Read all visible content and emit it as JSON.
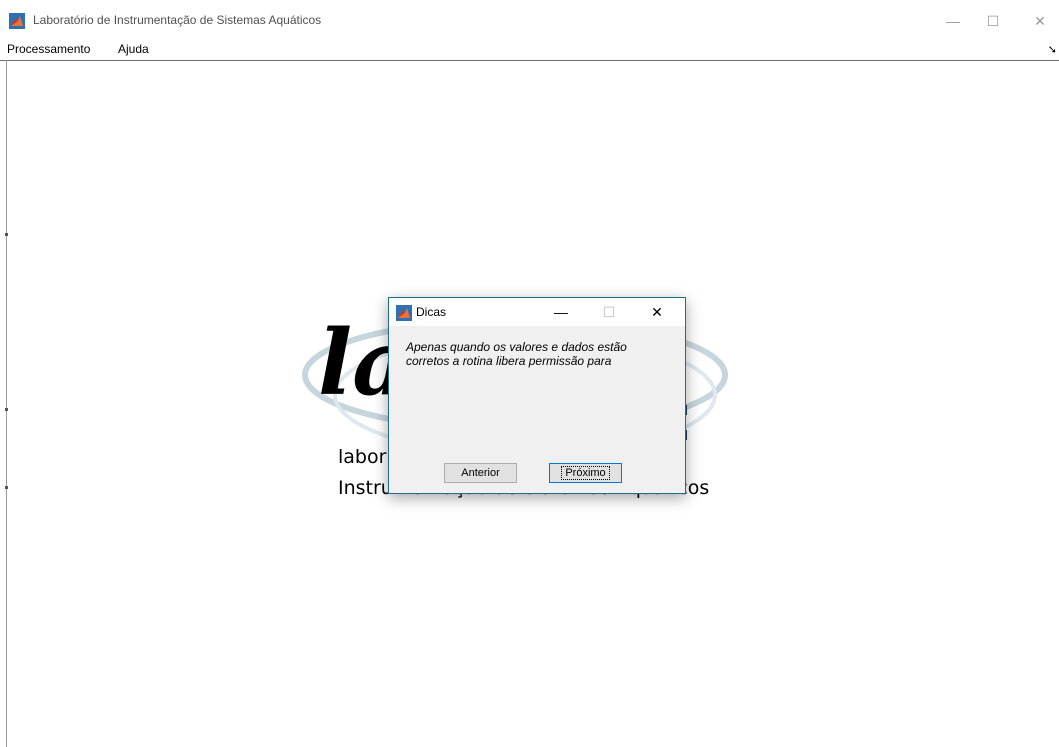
{
  "window": {
    "title": "Laboratório de Instrumentação de Sistemas Aquáticos",
    "minimize": "—",
    "maximize": "☐",
    "close": "✕"
  },
  "menu": {
    "items": [
      "Processamento",
      "Ajuda"
    ],
    "overflow_arrow": "➘"
  },
  "logo": {
    "line1": "labor",
    "line2": "Instrumentação de Sistemas Aquáticos",
    "accent_color": "#1a3a5c"
  },
  "dialog": {
    "title": "Dicas",
    "minimize": "—",
    "maximize": "☐",
    "close": "✕",
    "message": "Apenas quando os valores e dados estão corretos a rotina libera permissão para",
    "prev_label": "Anterior",
    "next_label": "Próximo"
  }
}
